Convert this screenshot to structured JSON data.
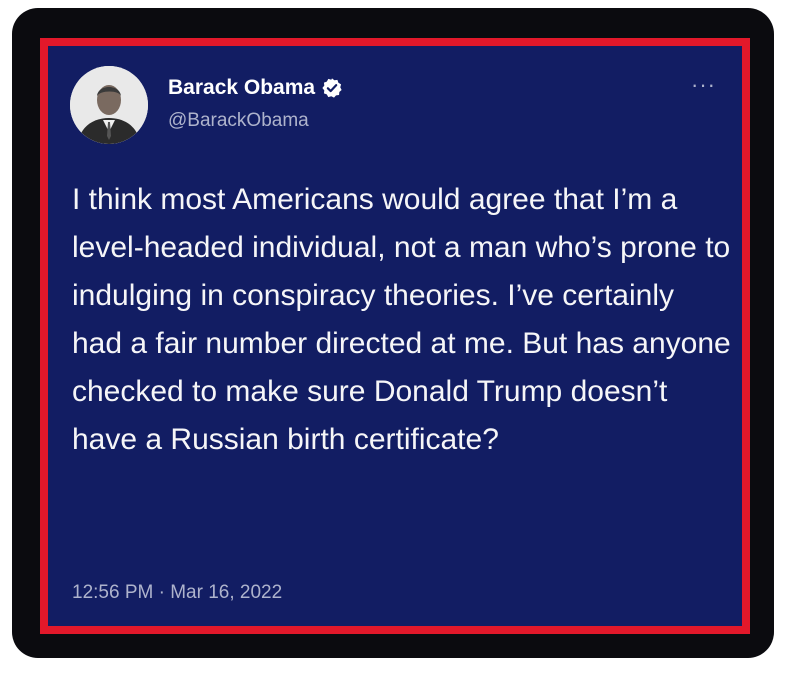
{
  "tweet": {
    "display_name": "Barack Obama",
    "handle": "@BarackObama",
    "more_label": "···",
    "text": "I think most Americans would agree that I’m a level-headed individual, not a man who’s prone to indulging in conspiracy theories. I’ve certainly had a fair number directed at me. But has anyone checked to make sure Donald Trump doesn’t have a Russian birth certificate?",
    "timestamp": "12:56 PM · Mar 16, 2022"
  },
  "colors": {
    "card_background": "#121d63",
    "border": "#e2182a",
    "frame": "#0b0b0f",
    "secondary_text": "#aeb3cc"
  },
  "icons": {
    "verified": "verified-badge-icon",
    "more": "more-options-icon"
  }
}
